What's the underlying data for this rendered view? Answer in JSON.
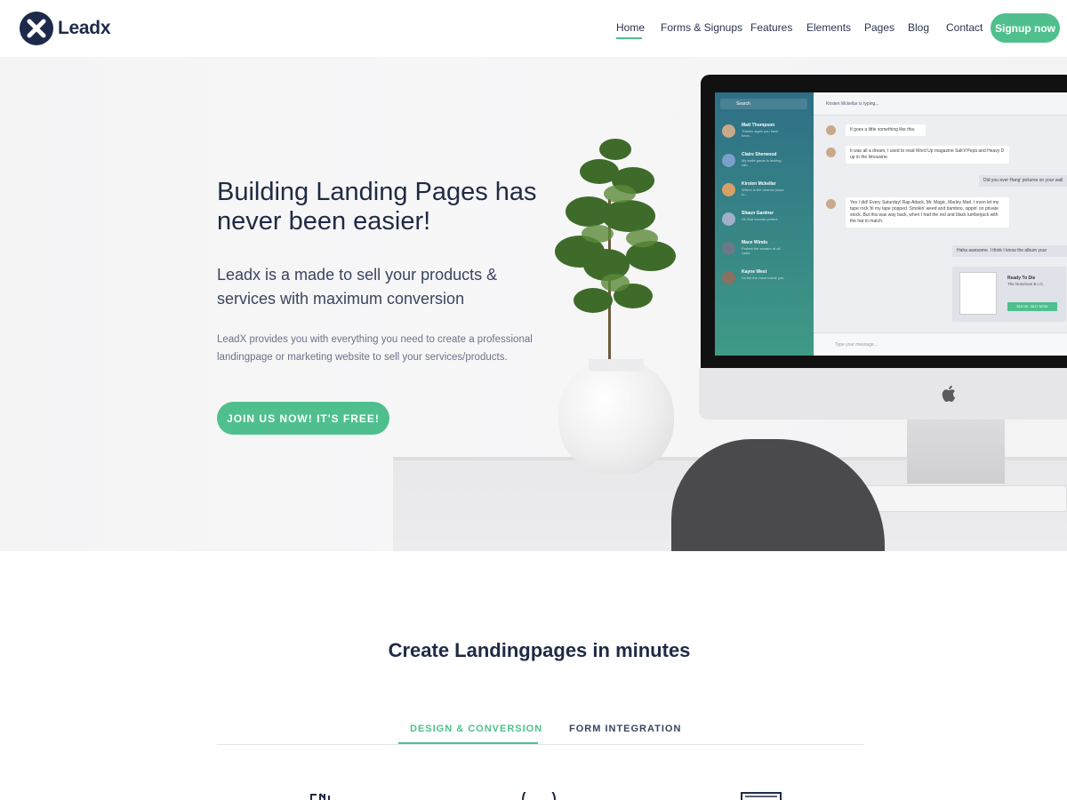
{
  "brand": {
    "name": "Leadx"
  },
  "nav": {
    "items": [
      {
        "label": "Home",
        "active": true
      },
      {
        "label": "Forms & Signups",
        "active": false
      },
      {
        "label": "Features",
        "active": false
      },
      {
        "label": "Elements",
        "active": false
      },
      {
        "label": "Pages",
        "active": false
      },
      {
        "label": "Blog",
        "active": false
      },
      {
        "label": "Contact",
        "active": false
      }
    ],
    "signup_label": "Signup now"
  },
  "hero": {
    "title": "Building Landing Pages has never been easier!",
    "subtitle": "Leadx is a made to sell your products & services with maximum conversion",
    "description": "LeadX provides you with everything you need to create a professional landingpage or marketing website to sell your services/products.",
    "cta_label": "JOIN US NOW! IT'S FREE!"
  },
  "mockup": {
    "search": "Search",
    "typing": "Kirsten Mckellar is typing...",
    "contacts": [
      {
        "name": "Matt Thompson",
        "msg": "Thanks again you have been..."
      },
      {
        "name": "Claire Sherwood",
        "msg": "My selfie game is lacking rain"
      },
      {
        "name": "Kirsten Mckellar",
        "msg": "Where is the nearest place to..."
      },
      {
        "name": "Shaun Gardner",
        "msg": "Oh that sounds perfect"
      },
      {
        "name": "Mace Windu",
        "msg": "Protect the senator at all costs"
      },
      {
        "name": "Kayne West",
        "msg": "So tell the voice inside you"
      }
    ],
    "messages": [
      "It goes a little something like this.",
      "It was all a dream, I used to read Word Up magazine Salt'n'Pepa and Heavy D up in the limousine.",
      "Did you ever Hang' pictures on your wall",
      "Yes I did! Every Saturday! Rap Attack, Mr. Magic, Marley Marl. I even let my tape rock 'til my tape popped. Smokin' weed and bamboo, sippin' on private stock. But this was way back, when I had the red and black lumberjack with the hat to match.",
      "Haha awesome. I think I know the album your"
    ],
    "album_title": "Ready To Die",
    "album_artist": "The Notorious B.I.G.",
    "album_buy": "$15.99 · BUY NOW",
    "input_placeholder": "Type your message..."
  },
  "section": {
    "title": "Create Landingpages in minutes",
    "tabs": [
      {
        "label": "DESIGN & CONVERSION",
        "active": true
      },
      {
        "label": "FORM INTEGRATION",
        "active": false
      }
    ]
  },
  "colors": {
    "accent": "#4fc08d",
    "navy": "#1e2a4a"
  },
  "icons": [
    "x-logo-icon",
    "apple-logo-icon",
    "search-icon",
    "star-icon"
  ]
}
